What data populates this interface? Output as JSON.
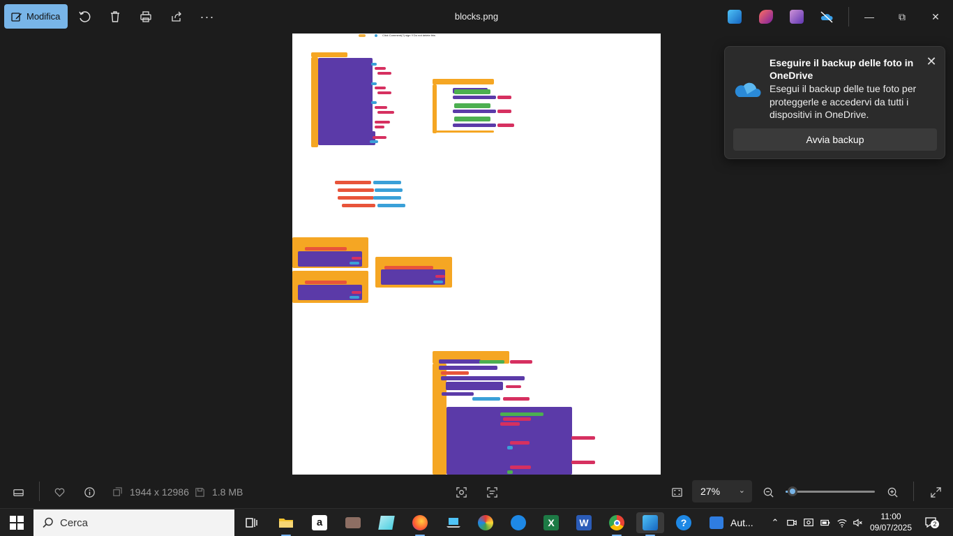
{
  "toolbar": {
    "edit_label": "Modifica",
    "file_title": "blocks.png"
  },
  "canvas": {
    "header_note": "Click Comment(?) sign !! Do not delete this"
  },
  "onedrive_popup": {
    "title": "Eseguire il backup delle foto in OneDrive",
    "body": "Esegui il backup delle tue foto per proteggerle e accedervi da tutti i dispositivi in OneDrive.",
    "button_label": "Avvia backup",
    "close_glyph": "✕"
  },
  "statusbar": {
    "dimensions": "1944 x 12986",
    "file_size": "1.8 MB",
    "zoom": "27%",
    "zoom_fraction": 0.08
  },
  "taskbar": {
    "search_placeholder": "Cerca",
    "active_app_label": "Aut...",
    "time": "11:00",
    "date": "09/07/2025",
    "notification_count": "2"
  },
  "colors": {
    "accent": "#78b5e8",
    "block_orange": "#f5a623",
    "block_purple": "#5b3aa8",
    "block_red": "#d63060"
  }
}
